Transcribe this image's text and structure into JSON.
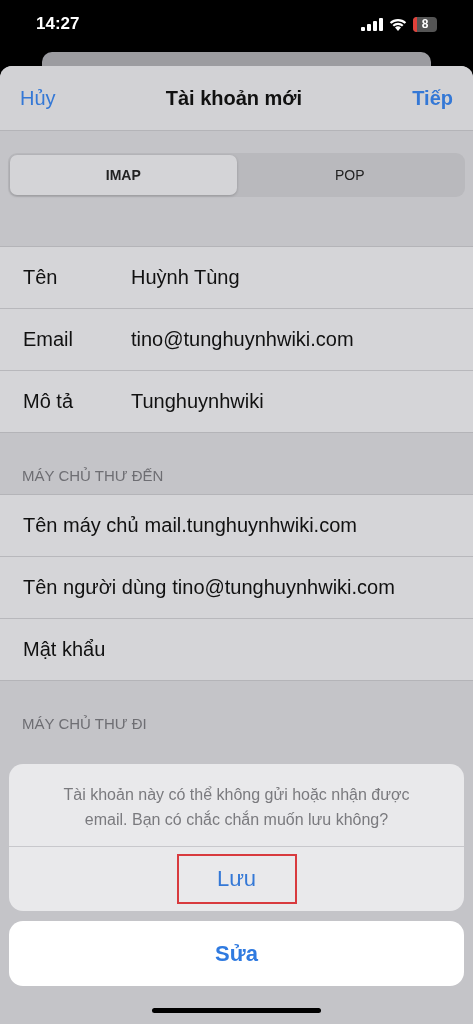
{
  "status_bar": {
    "time": "14:27",
    "battery": "8"
  },
  "nav": {
    "cancel": "Hủy",
    "title": "Tài khoản mới",
    "next": "Tiếp"
  },
  "segments": [
    {
      "label": "IMAP",
      "selected": true
    },
    {
      "label": "POP",
      "selected": false
    }
  ],
  "sections": [
    {
      "rows": [
        {
          "label": "Tên",
          "value": "Huỳnh Tùng"
        },
        {
          "label": "Email",
          "value": "tino@tunghuynhwiki.com"
        },
        {
          "label": "Mô tả",
          "value": "Tunghuynhwiki"
        }
      ]
    },
    {
      "header": "MÁY CHỦ THƯ ĐẾN",
      "rows": [
        {
          "label": "Tên máy chủ",
          "value": "mail.tunghuynhwiki.com"
        },
        {
          "label": "Tên người dùng",
          "value": "tino@tunghuynhwiki.com"
        },
        {
          "label": "Mật khẩu"
        }
      ]
    },
    {
      "header": "MÁY CHỦ THƯ ĐI"
    }
  ],
  "action_sheet": {
    "message": "Tài khoản này có thể không gửi hoặc nhận được email. Bạn có chắc chắn muốn lưu không?",
    "actions": [
      {
        "label": "Lưu",
        "highlighted": true
      }
    ],
    "cancel": "Sửa"
  }
}
